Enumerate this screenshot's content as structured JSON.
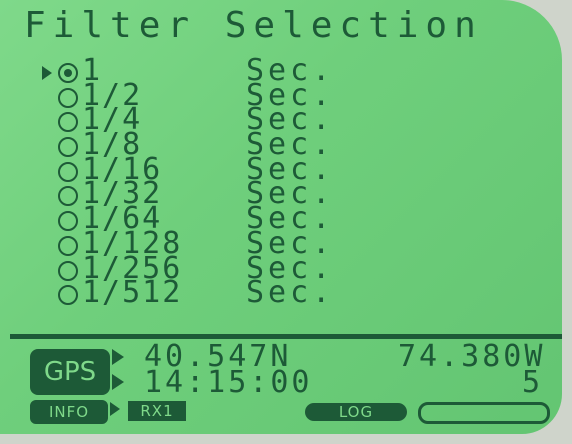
{
  "screen": {
    "title": "Filter Selection"
  },
  "filters": [
    {
      "value": "1",
      "unit": "Sec.",
      "selected": true,
      "pointer": true
    },
    {
      "value": "1/2",
      "unit": "Sec.",
      "selected": false,
      "pointer": false
    },
    {
      "value": "1/4",
      "unit": "Sec.",
      "selected": false,
      "pointer": false
    },
    {
      "value": "1/8",
      "unit": "Sec.",
      "selected": false,
      "pointer": false
    },
    {
      "value": "1/16",
      "unit": "Sec.",
      "selected": false,
      "pointer": false
    },
    {
      "value": "1/32",
      "unit": "Sec.",
      "selected": false,
      "pointer": false
    },
    {
      "value": "1/64",
      "unit": "Sec.",
      "selected": false,
      "pointer": false
    },
    {
      "value": "1/128",
      "unit": "Sec.",
      "selected": false,
      "pointer": false
    },
    {
      "value": "1/256",
      "unit": "Sec.",
      "selected": false,
      "pointer": false
    },
    {
      "value": "1/512",
      "unit": "Sec.",
      "selected": false,
      "pointer": false
    }
  ],
  "status": {
    "gps_label": "GPS",
    "latitude": "40.547N",
    "longitude": "74.380W",
    "time": "14:15:00",
    "satellites": "5",
    "info_label": "INFO",
    "rx_label": "RX1",
    "log_label": "LOG",
    "progress_fraction": 0
  },
  "colors": {
    "lcd_background": "#6fcf7c",
    "lcd_ink": "#1d5a37"
  }
}
